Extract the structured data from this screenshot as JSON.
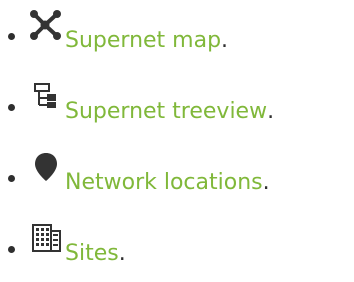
{
  "items": [
    {
      "icon": "supernet-map-icon",
      "label": "Supernet map",
      "punctuation": "."
    },
    {
      "icon": "treeview-icon",
      "label": "Supernet treeview",
      "punctuation": "."
    },
    {
      "icon": "map-pin-icon",
      "label": "Network locations",
      "punctuation": "."
    },
    {
      "icon": "building-icon",
      "label": "Sites",
      "punctuation": "."
    }
  ],
  "colors": {
    "link": "#80b83a",
    "text": "#2f2f2f"
  }
}
